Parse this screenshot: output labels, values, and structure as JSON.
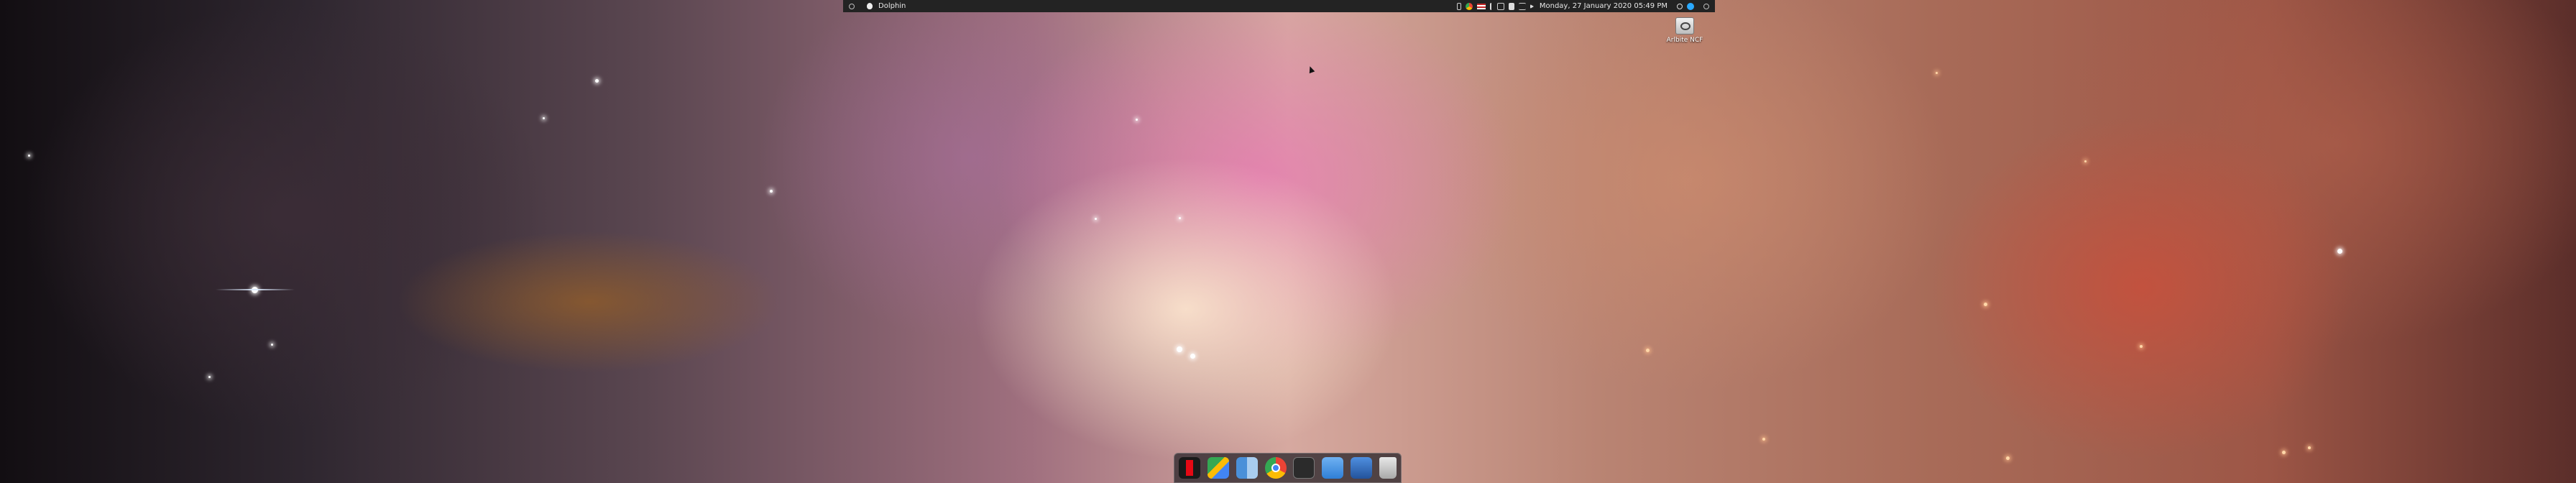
{
  "top_panel": {
    "app_name": "Dolphin",
    "datetime": "Monday, 27 January 2020 05:49 PM",
    "tray_icons": [
      "battery-icon",
      "chrome-icon",
      "flag-us-icon",
      "bluetooth-icon",
      "network-icon",
      "clipboard-icon",
      "code-icon",
      "volume-icon"
    ],
    "right_icons": [
      "search-icon",
      "notification-icon",
      "power-icon"
    ]
  },
  "desktop_icons": [
    {
      "label": "Arlbite NCF",
      "icon": "drive-icon"
    }
  ],
  "dock": {
    "items": [
      {
        "name": "netflix-icon",
        "color": "#e50914"
      },
      {
        "name": "maps-icon",
        "color": "#34a853"
      },
      {
        "name": "finder-icon",
        "color": "#5b9bd5"
      },
      {
        "name": "chrome-icon",
        "color": "#fbbc05"
      },
      {
        "name": "terminal-icon",
        "color": "#2b2b2b"
      },
      {
        "name": "files-icon",
        "color": "#3c8ee6"
      },
      {
        "name": "downloads-icon",
        "color": "#2f6fc2"
      },
      {
        "name": "trash-icon",
        "color": "#cfcfcf"
      }
    ]
  }
}
